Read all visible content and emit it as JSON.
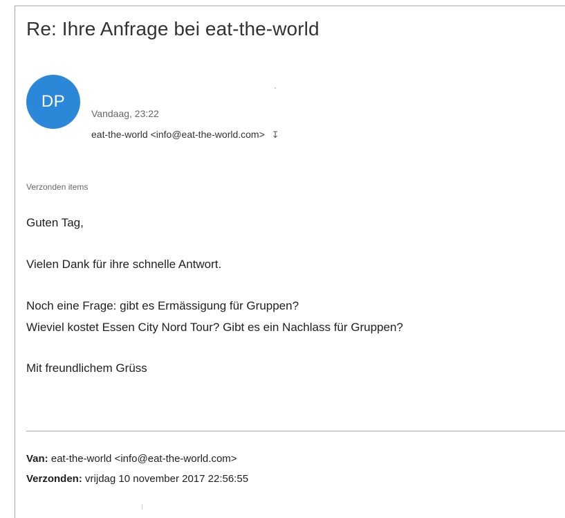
{
  "email": {
    "subject": "Re: Ihre Anfrage bei eat-the-world",
    "avatar_initials": "DP",
    "avatar_color": "#2b88d8",
    "date": "Vandaag, 23:22",
    "sender": "eat-the-world <info@eat-the-world.com>",
    "expand_icon": "chevron-double-down-icon",
    "folder": "Verzonden items",
    "body_lines": [
      "Guten Tag,",
      "Vielen Dank für ihre schnelle Antwort.",
      "Noch eine Frage: gibt es Ermässigung für Gruppen?",
      "Wieviel kostet Essen City Nord Tour? Gibt es ein Nachlass für Gruppen?",
      "Mit freundlichem Grüss"
    ],
    "quoted": {
      "from_label": "Van:",
      "from_value": "eat-the-world <info@eat-the-world.com>",
      "sent_label": "Verzonden:",
      "sent_value": "vrijdag 10 november 2017 22:56:55"
    }
  }
}
